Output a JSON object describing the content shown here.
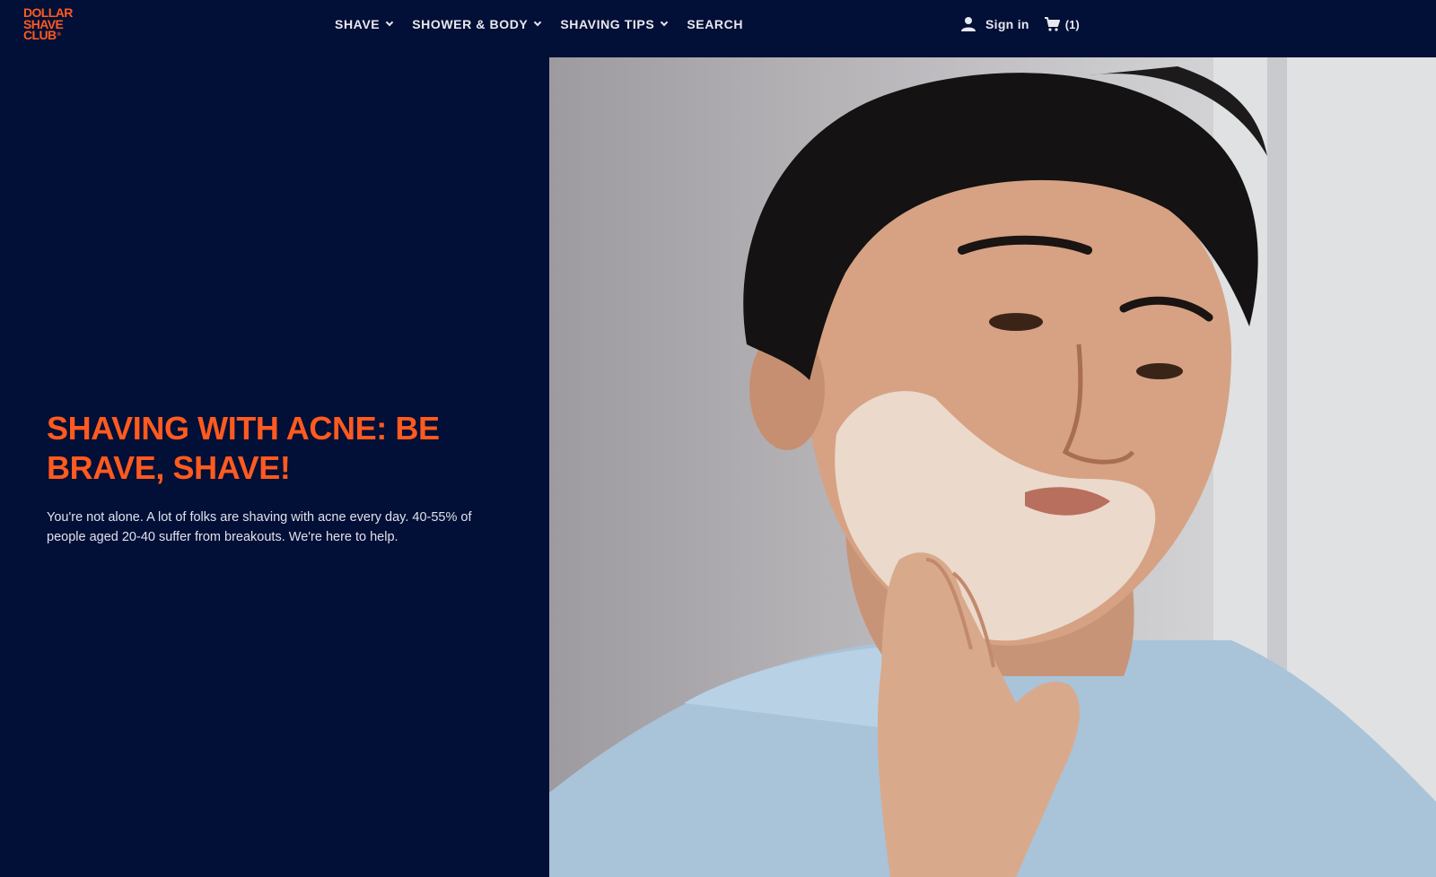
{
  "brand": {
    "logo_lines": [
      "DOLLAR",
      "SHAVE",
      "CLUB"
    ],
    "accent": "#ff5a1f",
    "background": "#020f36"
  },
  "nav": {
    "items": [
      {
        "label": "SHAVE",
        "has_dropdown": true
      },
      {
        "label": "SHOWER & BODY",
        "has_dropdown": true
      },
      {
        "label": "SHAVING TIPS",
        "has_dropdown": true
      },
      {
        "label": "SEARCH",
        "has_dropdown": false
      }
    ]
  },
  "account": {
    "signin_label": "Sign in",
    "cart_count": "(1)",
    "icons": [
      "user-icon",
      "cart-icon"
    ]
  },
  "hero": {
    "title": "SHAVING WITH ACNE: BE BRAVE, SHAVE!",
    "subtitle": "You're not alone. A lot of folks are shaving with acne every day. 40-55% of people aged 20-40 suffer from breakouts. We're here to help."
  }
}
